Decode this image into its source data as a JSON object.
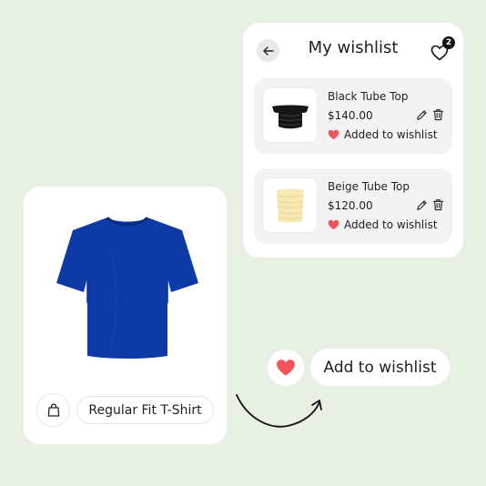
{
  "wishlist": {
    "title": "My wishlist",
    "count": "2",
    "items": [
      {
        "name": "Black Tube Top",
        "price": "$140.00",
        "status": "Added to wishlist",
        "color": "#1a1a1a"
      },
      {
        "name": "Beige Tube Top",
        "price": "$120.00",
        "status": "Added to wishlist",
        "color": "#f7e9b4"
      }
    ]
  },
  "product": {
    "name": "Regular Fit T-Shirt",
    "color": "#0e3aa8"
  },
  "add_to_wishlist": {
    "label": "Add to wishlist"
  },
  "colors": {
    "background": "#e8f0e3",
    "heart": "#f0555c",
    "card": "#ffffff"
  },
  "icons": [
    "back-arrow-icon",
    "heart-outline-icon",
    "edit-pencil-icon",
    "trash-icon",
    "heart-filled-icon",
    "shopping-bag-icon",
    "curved-arrow"
  ]
}
